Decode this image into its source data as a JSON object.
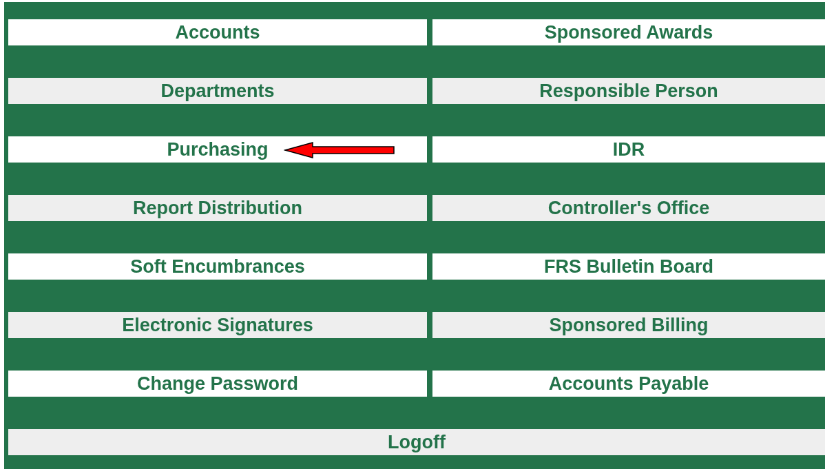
{
  "menu": [
    {
      "label": "Accounts",
      "pointer": false
    },
    {
      "label": "Sponsored Awards",
      "pointer": false
    },
    {
      "label": "Departments",
      "pointer": false
    },
    {
      "label": "Responsible Person",
      "pointer": false
    },
    {
      "label": "Purchasing",
      "pointer": true
    },
    {
      "label": "IDR",
      "pointer": false
    },
    {
      "label": "Report Distribution",
      "pointer": false
    },
    {
      "label": "Controller's Office",
      "pointer": false
    },
    {
      "label": "Soft Encumbrances",
      "pointer": false
    },
    {
      "label": "FRS Bulletin Board",
      "pointer": false
    },
    {
      "label": "Electronic Signatures",
      "pointer": false
    },
    {
      "label": "Sponsored Billing",
      "pointer": false
    },
    {
      "label": "Change Password",
      "pointer": false
    },
    {
      "label": "Accounts Payable",
      "pointer": false
    }
  ],
  "logoff": {
    "label": "Logoff"
  }
}
